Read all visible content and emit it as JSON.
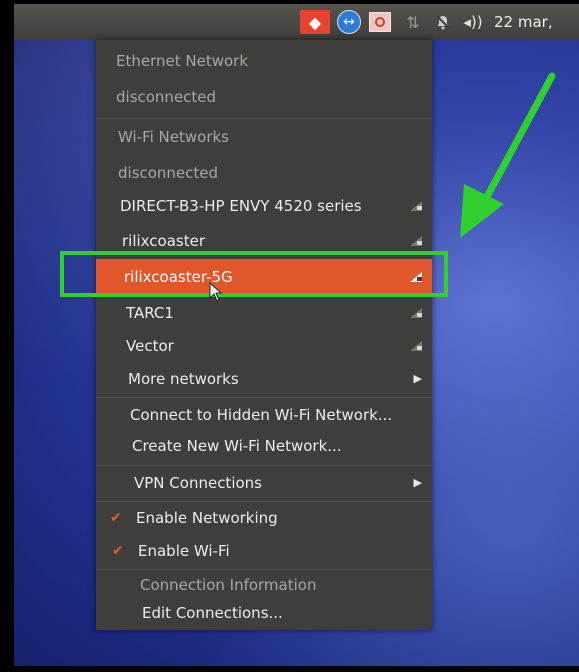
{
  "panel": {
    "clock": "22 mar,",
    "tray_icons": [
      "transfer-icon",
      "teamviewer-icon",
      "stop-icon",
      "network-icon",
      "bell-muted-icon",
      "volume-icon"
    ]
  },
  "menu": {
    "ethernet_header": "Ethernet Network",
    "ethernet_status": "disconnected",
    "wifi_header": "Wi-Fi Networks",
    "wifi_status": "disconnected",
    "networks": [
      {
        "name": "DIRECT-B3-HP ENVY 4520 series",
        "icon": "wifi-lock-icon"
      },
      {
        "name": "rilixcoaster",
        "icon": "wifi-lock-icon"
      },
      {
        "name": "rilixcoaster-5G",
        "icon": "wifi-lock-icon",
        "highlighted": true
      },
      {
        "name": "TARC1",
        "icon": "wifi-lock-icon"
      },
      {
        "name": "Vector",
        "icon": "wifi-lock-icon"
      }
    ],
    "more_networks": "More networks",
    "connect_hidden": "Connect to Hidden Wi-Fi Network...",
    "create_new": "Create New Wi-Fi Network...",
    "vpn": "VPN Connections",
    "enable_networking": "Enable Networking",
    "enable_wifi": "Enable Wi-Fi",
    "connection_info": "Connection Information",
    "edit_connections": "Edit Connections..."
  },
  "colors": {
    "highlight": "#e1572c",
    "annotation": "#2fd12f",
    "menu_bg": "#3e3e3c"
  }
}
